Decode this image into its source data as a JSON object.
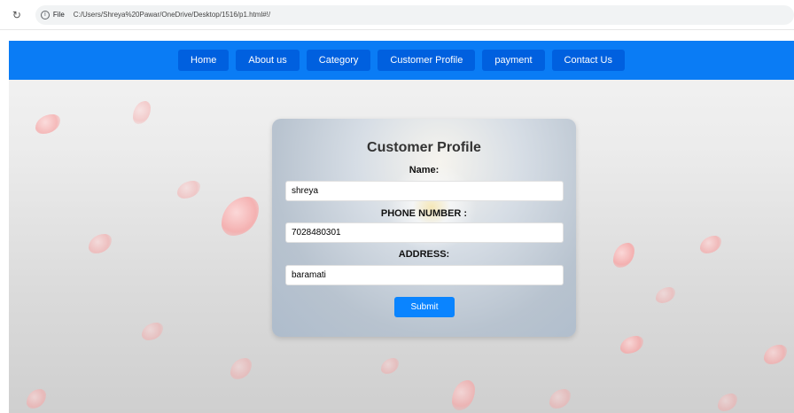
{
  "browser": {
    "reload_icon": "reload-icon",
    "info_icon": "info-icon",
    "file_label": "File",
    "url": "C:/Users/Shreya%20Pawar/OneDrive/Desktop/1516/p1.html#!/"
  },
  "nav": {
    "items": [
      {
        "label": "Home"
      },
      {
        "label": "About us"
      },
      {
        "label": "Category"
      },
      {
        "label": "Customer Profile"
      },
      {
        "label": "payment"
      },
      {
        "label": "Contact Us"
      }
    ]
  },
  "form": {
    "title": "Customer Profile",
    "name_label": "Name:",
    "name_value": "shreya",
    "phone_label": "PHONE NUMBER :",
    "phone_value": "7028480301",
    "address_label": "ADDRESS:",
    "address_value": "baramati",
    "submit_label": "Submit"
  },
  "colors": {
    "nav_bar": "#0a7cf5",
    "nav_button": "#0060df",
    "submit_button": "#0a84ff"
  }
}
